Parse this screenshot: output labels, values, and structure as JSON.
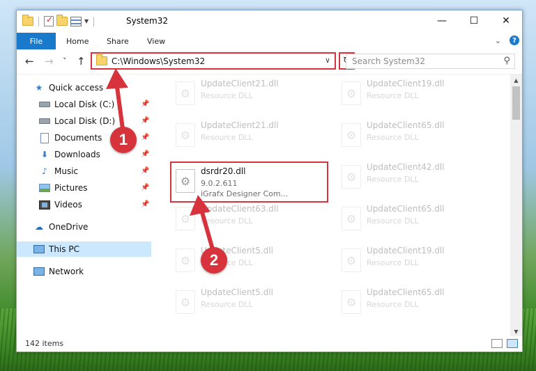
{
  "window": {
    "title": "System32",
    "controls": {
      "minimize": "—",
      "maximize": "☐",
      "close": "✕"
    }
  },
  "ribbon": {
    "tabs": [
      "File",
      "Home",
      "Share",
      "View"
    ],
    "help": "?"
  },
  "navbar": {
    "back": "←",
    "forward": "→",
    "recent": "˅",
    "up": "↑",
    "address": "C:\\Windows\\System32",
    "address_dropdown": "∨",
    "refresh": "↻",
    "search_placeholder": "Search System32",
    "search_icon": "magnifier-icon"
  },
  "sidebar": {
    "quick_access": "Quick access",
    "items": [
      {
        "label": "Local Disk (C:)",
        "icon": "drive-icon",
        "pinned": true
      },
      {
        "label": "Local Disk (D:)",
        "icon": "drive-icon",
        "pinned": true
      },
      {
        "label": "Documents",
        "icon": "documents-icon",
        "pinned": true
      },
      {
        "label": "Downloads",
        "icon": "downloads-icon",
        "pinned": true
      },
      {
        "label": "Music",
        "icon": "music-icon",
        "pinned": true
      },
      {
        "label": "Pictures",
        "icon": "pictures-icon",
        "pinned": true
      },
      {
        "label": "Videos",
        "icon": "videos-icon",
        "pinned": true
      }
    ],
    "onedrive": "OneDrive",
    "this_pc": "This PC",
    "network": "Network"
  },
  "files": {
    "left_column": [
      {
        "name": "UpdateClient21.dll",
        "type": "Resource DLL",
        "faded": true
      },
      {
        "name": "UpdateClient21.dll",
        "type": "Resource DLL",
        "faded": true
      },
      {
        "name": "dsrdr20.dll",
        "version": "9.0.2.611",
        "company": "iGrafx Designer Com...",
        "faded": false,
        "highlighted": true
      },
      {
        "name": "UpdateClient63.dll",
        "type": "Resource DLL",
        "faded": true
      },
      {
        "name": "UpdateClient5.dll",
        "type": "Resource DLL",
        "faded": true
      },
      {
        "name": "UpdateClient5.dll",
        "type": "Resource DLL",
        "faded": true
      }
    ],
    "right_column": [
      {
        "name": "UpdateClient19.dll",
        "type": "Resource DLL",
        "faded": true
      },
      {
        "name": "UpdateClient65.dll",
        "type": "Resource DLL",
        "faded": true
      },
      {
        "name": "UpdateClient42.dll",
        "type": "Resource DLL",
        "faded": true
      },
      {
        "name": "UpdateClient65.dll",
        "type": "Resource DLL",
        "faded": true
      },
      {
        "name": "UpdateClient19.dll",
        "type": "Resource DLL",
        "faded": true
      },
      {
        "name": "UpdateClient65.dll",
        "type": "Resource DLL",
        "faded": true
      }
    ]
  },
  "status": {
    "item_count": "142 items"
  },
  "annotations": {
    "callout_1": "1",
    "callout_2": "2",
    "accent_color": "#d6333c"
  },
  "colors": {
    "file_tab": "#1979ca",
    "selection": "#cce8ff"
  }
}
